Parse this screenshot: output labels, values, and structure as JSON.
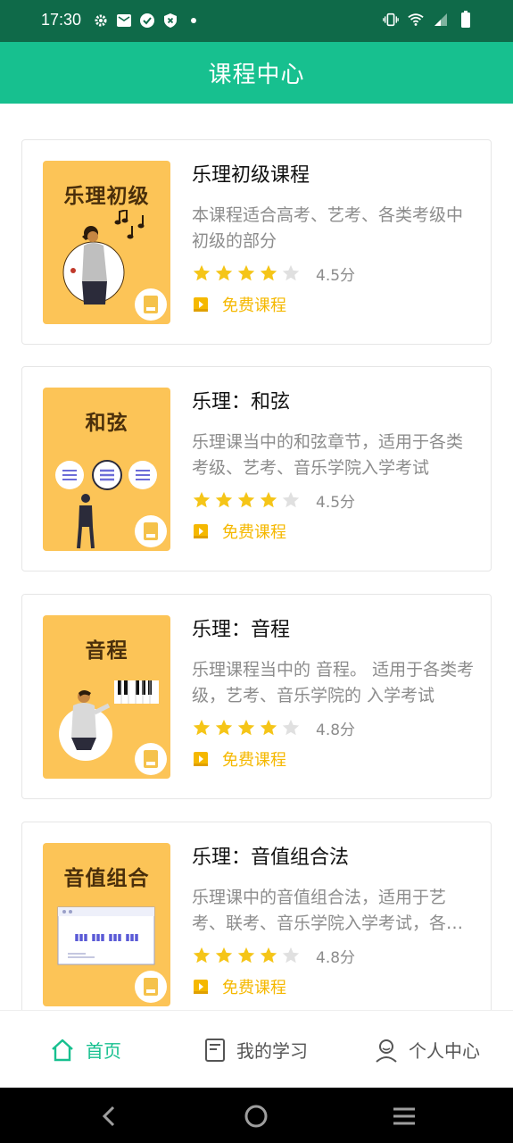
{
  "status_bar": {
    "time": "17:30",
    "left_icons": [
      "gear-icon",
      "mail-icon",
      "check-circle-icon",
      "shield-icon",
      "dot-icon"
    ],
    "right_icons": [
      "vibrate-icon",
      "wifi-icon",
      "signal-icon",
      "battery-icon"
    ]
  },
  "header": {
    "title": "课程中心"
  },
  "courses": [
    {
      "thumb_title": "乐理初级",
      "title": "乐理初级课程",
      "description": "本课程适合高考、艺考、各类考级中初级的部分",
      "rating": 4.5,
      "score_label": "4.5分",
      "badge": "免费课程"
    },
    {
      "thumb_title": "和弦",
      "title": "乐理：和弦",
      "description": "乐理课当中的和弦章节，适用于各类考级、艺考、音乐学院入学考试",
      "rating": 4.5,
      "score_label": "4.5分",
      "badge": "免费课程"
    },
    {
      "thumb_title": "音程",
      "title": "乐理：音程",
      "description": "乐理课程当中的 音程。 适用于各类考级，艺考、音乐学院的 入学考试",
      "rating": 4.8,
      "score_label": "4.8分",
      "badge": "免费课程"
    },
    {
      "thumb_title": "音值组合",
      "title": "乐理：音值组合法",
      "description": "乐理课中的音值组合法，适用于艺考、联考、音乐学院入学考试，各类考级",
      "rating": 4.8,
      "score_label": "4.8分",
      "badge": "免费课程"
    }
  ],
  "tabs": [
    {
      "label": "首页",
      "icon": "home-icon",
      "active": true
    },
    {
      "label": "我的学习",
      "icon": "document-icon",
      "active": false
    },
    {
      "label": "个人中心",
      "icon": "user-icon",
      "active": false
    }
  ],
  "nav_buttons": [
    "back-icon",
    "home-circle-icon",
    "menu-icon"
  ],
  "colors": {
    "status_bar": "#0f6a49",
    "header": "#17c08f",
    "active_tab": "#17c08f",
    "inactive_tab": "#555555",
    "star": "#f5c518",
    "badge": "#f5b800",
    "thumb": "#fcc457"
  }
}
